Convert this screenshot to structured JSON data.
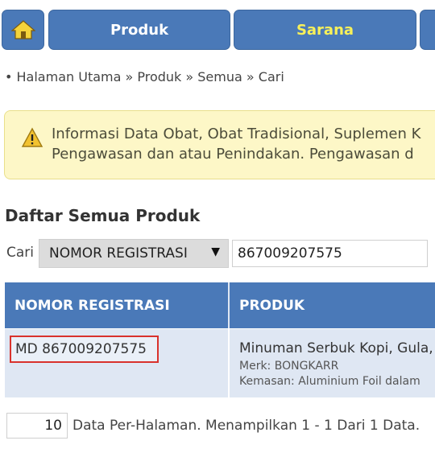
{
  "nav": {
    "home_icon": "home-icon",
    "tabs": [
      {
        "label": "Produk"
      },
      {
        "label": "Sarana"
      }
    ]
  },
  "breadcrumb": "• Halaman Utama » Produk » Semua » Cari",
  "info": {
    "icon": "warning-icon",
    "line1": "Informasi Data Obat, Obat Tradisional, Suplemen K",
    "line2": "Pengawasan dan atau Penindakan. Pengawasan d"
  },
  "page_title": "Daftar Semua Produk",
  "search": {
    "label": "Cari",
    "field_selected": "NOMOR REGISTRASI",
    "query": "867009207575"
  },
  "table": {
    "headers": [
      "NOMOR REGISTRASI",
      "PRODUK"
    ],
    "rows": [
      {
        "registration": "MD 867009207575",
        "product": "Minuman Serbuk Kopi, Gula,",
        "merk": "Merk: BONGKARR",
        "kemasan": "Kemasan: Aluminium Foil dalam"
      }
    ]
  },
  "pagination": {
    "per_page": "10",
    "summary": "Data Per-Halaman. Menampilkan 1 - 1 Dari 1 Data."
  },
  "colors": {
    "nav_blue": "#4a79b8",
    "sarana_text": "#f7f05a",
    "info_bg": "#fdf7c7",
    "highlight_border": "#d9322c"
  }
}
